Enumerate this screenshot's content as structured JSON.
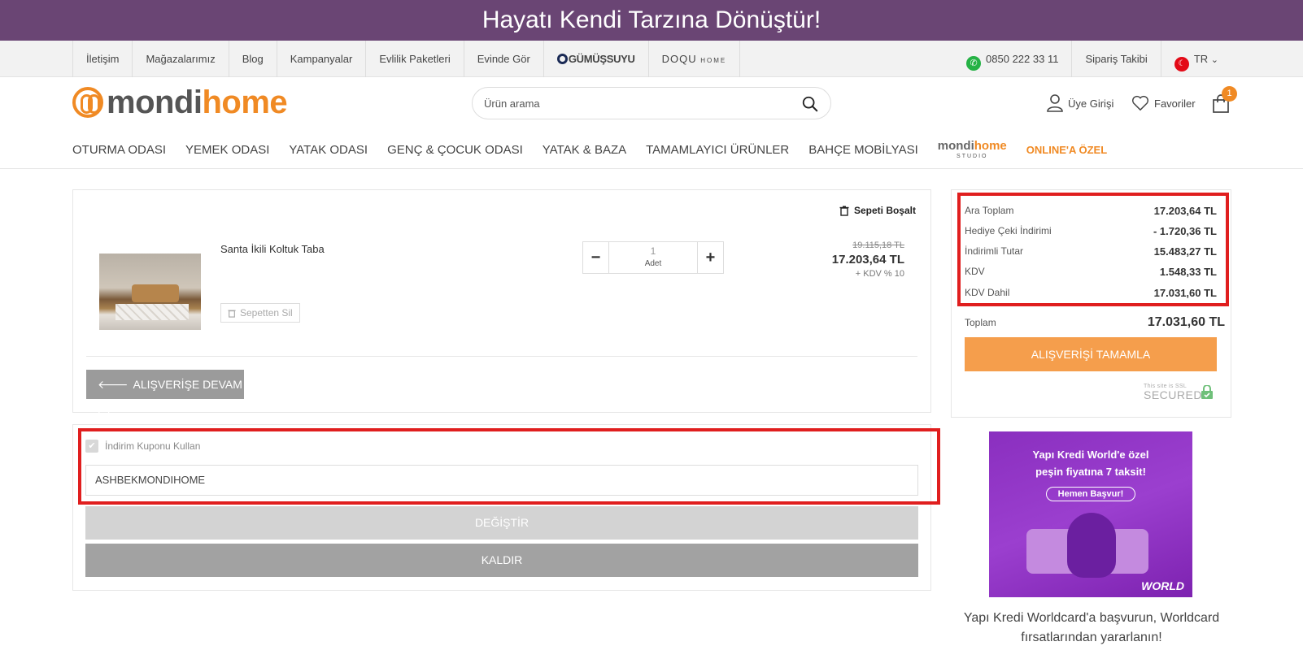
{
  "banner": {
    "text": "Hayatı Kendi Tarzına Dönüştür!"
  },
  "topnav": {
    "left": [
      "İletişim",
      "Mağazalarımız",
      "Blog",
      "Kampanyalar",
      "Evlilik Paketleri",
      "Evinde Gör"
    ],
    "brand1": "GÜMÜŞSUYU",
    "brand2_main": "DOQU",
    "brand2_sub": "HOME",
    "phone": "0850 222 33 11",
    "order_tracking": "Sipariş Takibi",
    "language": "TR"
  },
  "header": {
    "logo_part1": "mondi",
    "logo_part2": "home",
    "search_placeholder": "Ürün arama",
    "login": "Üye Girişi",
    "favorites": "Favoriler",
    "cart_count": "1"
  },
  "mainnav": {
    "items": [
      "OTURMA ODASI",
      "YEMEK ODASI",
      "YATAK ODASI",
      "GENÇ & ÇOCUK ODASI",
      "YATAK & BAZA",
      "TAMAMLAYICI ÜRÜNLER",
      "BAHÇE MOBİLYASI"
    ],
    "studio_part1": "mondi",
    "studio_part2": "home",
    "studio_sub": "STUDIO",
    "special": "ONLINE'A ÖZEL"
  },
  "cart": {
    "empty_label": "Sepeti Boşalt",
    "item": {
      "name": "Santa İkili Koltuk Taba",
      "remove_label": "Sepetten Sil",
      "quantity": "1",
      "unit": "Adet",
      "old_price": "19.115,18 TL",
      "price": "17.203,64 TL",
      "vat_note": "+ KDV % 10"
    },
    "continue_label": "ALIŞVERİŞE DEVAM ET"
  },
  "coupon": {
    "checkbox_label": "İndirim Kuponu Kullan",
    "code": "ASHBEKMONDIHOME",
    "change_label": "DEĞİŞTİR",
    "remove_label": "KALDIR"
  },
  "summary": {
    "rows": [
      {
        "label": "Ara Toplam",
        "value": "17.203,64 TL"
      },
      {
        "label": "Hediye Çeki İndirimi",
        "value": "- 1.720,36 TL"
      },
      {
        "label": "İndirimli Tutar",
        "value": "15.483,27 TL"
      },
      {
        "label": "KDV",
        "value": "1.548,33 TL"
      },
      {
        "label": "KDV Dahil",
        "value": "17.031,60 TL"
      }
    ],
    "total_label": "Toplam",
    "total_value": "17.031,60 TL",
    "checkout_label": "ALIŞVERİŞİ TAMAMLA",
    "ssl_line1": "This site is SSL",
    "ssl_line2": "SECURED"
  },
  "ad": {
    "headline1": "Yapı Kredi World'e özel",
    "headline2": "peşin fiyatına 7 taksit!",
    "cta": "Hemen Başvur!",
    "brand": "WORLD",
    "caption": "Yapı Kredi Worldcard'a başvurun, Worldcard fırsatlarından yararlanın!"
  },
  "colors": {
    "banner": "#6a4574",
    "accent": "#f08a24",
    "checkout": "#f59e4c",
    "highlight": "#e01e1e"
  }
}
